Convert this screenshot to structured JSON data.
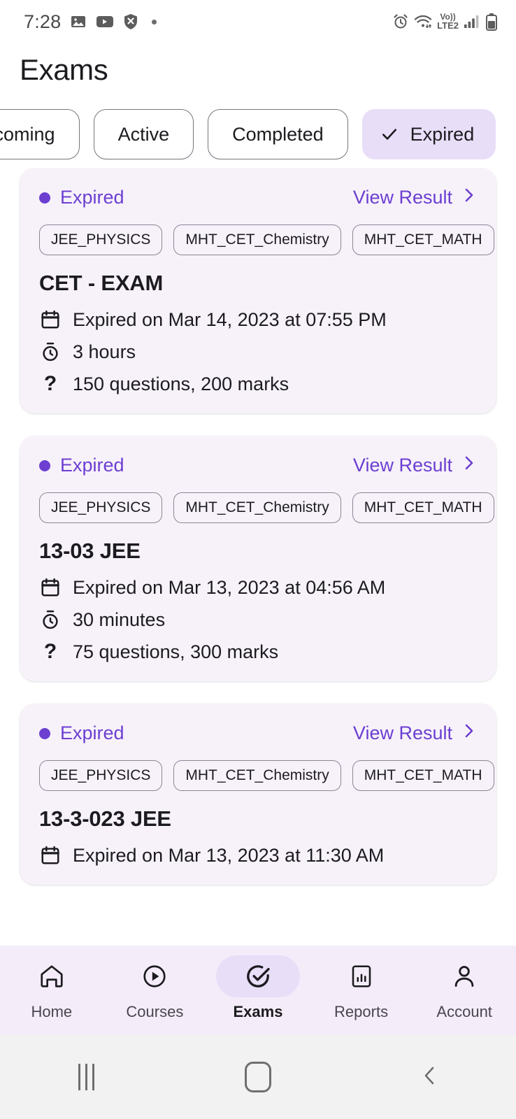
{
  "status_bar": {
    "time": "7:28",
    "left_icons": [
      "gallery-icon",
      "youtube-icon",
      "shield-blocked-icon",
      "dot-indicator"
    ],
    "right_icons": [
      "alarm-icon",
      "wifi-icon",
      "volte-icon",
      "signal-icon",
      "battery-icon"
    ],
    "volte_top": "Vo))",
    "volte_bottom": "LTE2"
  },
  "header": {
    "title": "Exams"
  },
  "tabs": [
    {
      "label": "Upcoming",
      "selected": false
    },
    {
      "label": "Active",
      "selected": false
    },
    {
      "label": "Completed",
      "selected": false
    },
    {
      "label": "Expired",
      "selected": true
    }
  ],
  "exam_cards": [
    {
      "status": "Expired",
      "action": "View Result",
      "chips": [
        "JEE_PHYSICS",
        "MHT_CET_Chemistry",
        "MHT_CET_MATH"
      ],
      "name": "CET - EXAM",
      "expiry": "Expired on Mar 14, 2023 at 07:55 PM",
      "duration": "3 hours",
      "questions": "150 questions, 200 marks"
    },
    {
      "status": "Expired",
      "action": "View Result",
      "chips": [
        "JEE_PHYSICS",
        "MHT_CET_Chemistry",
        "MHT_CET_MATH"
      ],
      "name": "13-03 JEE",
      "expiry": "Expired on Mar 13, 2023 at 04:56 AM",
      "duration": "30 minutes",
      "questions": "75 questions, 300 marks"
    },
    {
      "status": "Expired",
      "action": "View Result",
      "chips": [
        "JEE_PHYSICS",
        "MHT_CET_Chemistry",
        "MHT_CET_MATH"
      ],
      "name": "13-3-023 JEE",
      "expiry": "Expired on Mar 13, 2023 at 11:30 AM",
      "duration": "",
      "questions": ""
    }
  ],
  "bottom_nav": [
    {
      "label": "Home",
      "icon": "home-icon",
      "active": false
    },
    {
      "label": "Courses",
      "icon": "play-circle-icon",
      "active": false
    },
    {
      "label": "Exams",
      "icon": "check-circle-icon",
      "active": true
    },
    {
      "label": "Reports",
      "icon": "bar-chart-icon",
      "active": false
    },
    {
      "label": "Account",
      "icon": "person-icon",
      "active": false
    }
  ],
  "system_nav": [
    {
      "name": "recents-button"
    },
    {
      "name": "home-button"
    },
    {
      "name": "back-button"
    }
  ],
  "colors": {
    "accent_purple": "#6C3FD1",
    "card_bg": "#F7F2FA",
    "selected_tab_bg": "#E8DEF8",
    "bottom_nav_bg": "#F4EDF9",
    "text_primary": "#1C1B1F"
  }
}
